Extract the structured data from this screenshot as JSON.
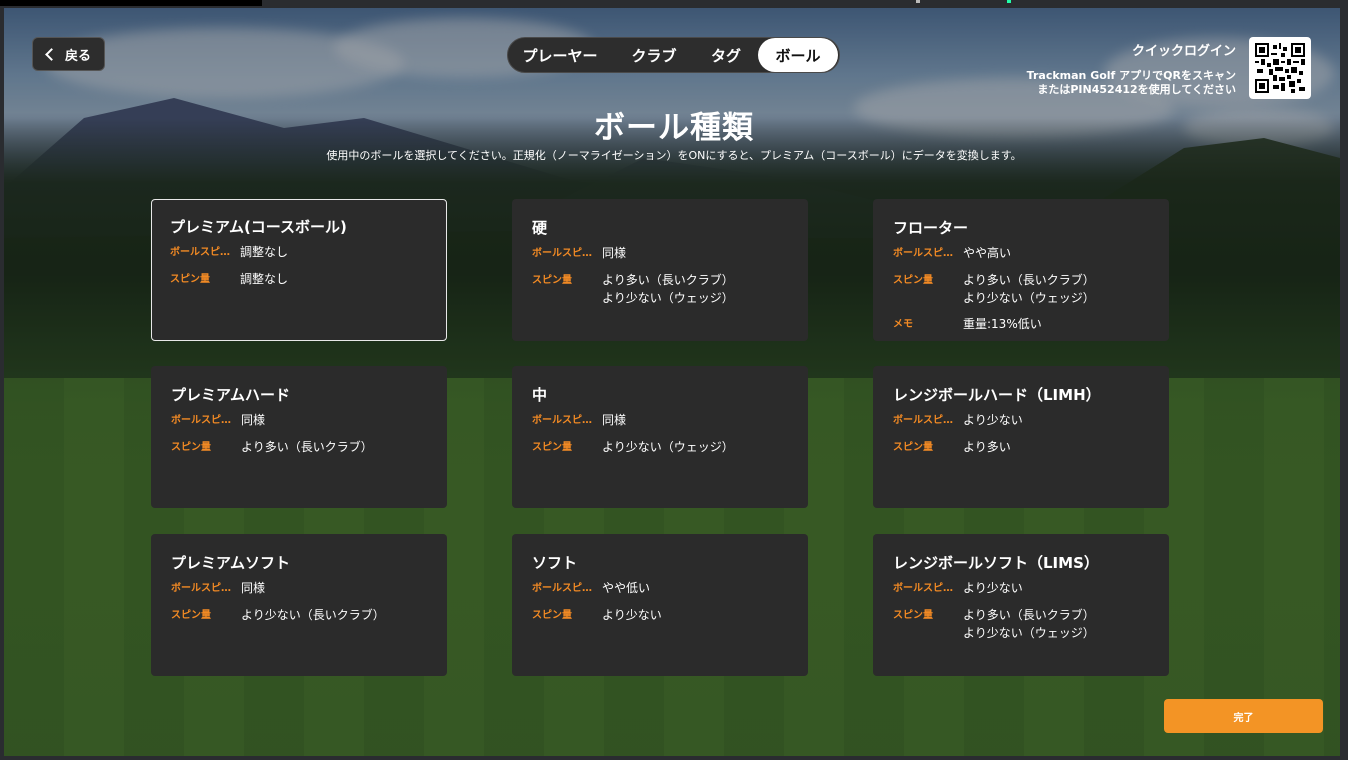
{
  "header": {
    "back_label": "戻る",
    "tabs": [
      {
        "label": "プレーヤー",
        "active": false
      },
      {
        "label": "クラブ",
        "active": false
      },
      {
        "label": "タグ",
        "active": false
      },
      {
        "label": "ボール",
        "active": true
      }
    ],
    "quick_login": {
      "title": "クイックログイン",
      "line1": "Trackman Golf アプリでQRをスキャン",
      "line2": "またはPIN452412を使用してください"
    }
  },
  "page": {
    "title": "ボール種類",
    "subtitle": "使用中のボールを選択してください。正規化（ノーマライゼーション）をONにすると、プレミアム（コースボール）にデータを変換します。"
  },
  "cards": [
    {
      "name": "プレミアム(コースボール)",
      "selected": true,
      "rows": [
        {
          "key": "ボールスピ…",
          "value": "調整なし"
        },
        {
          "key": "スピン量",
          "value": "調整なし"
        }
      ]
    },
    {
      "name": "硬",
      "selected": false,
      "rows": [
        {
          "key": "ボールスピ…",
          "value": "同様"
        },
        {
          "key": "スピン量",
          "value": "より多い（長いクラブ）\nより少ない（ウェッジ）"
        }
      ]
    },
    {
      "name": "フローター",
      "selected": false,
      "rows": [
        {
          "key": "ボールスピ…",
          "value": "やや高い"
        },
        {
          "key": "スピン量",
          "value": "より多い（長いクラブ）\nより少ない（ウェッジ）"
        },
        {
          "key": "メモ",
          "value": "重量:13%低い"
        }
      ]
    },
    {
      "name": "プレミアムハード",
      "selected": false,
      "rows": [
        {
          "key": "ボールスピ…",
          "value": "同様"
        },
        {
          "key": "スピン量",
          "value": "より多い（長いクラブ）"
        }
      ]
    },
    {
      "name": "中",
      "selected": false,
      "rows": [
        {
          "key": "ボールスピ…",
          "value": "同様"
        },
        {
          "key": "スピン量",
          "value": "より少ない（ウェッジ）"
        }
      ]
    },
    {
      "name": "レンジボールハード（LIMH）",
      "selected": false,
      "rows": [
        {
          "key": "ボールスピ…",
          "value": "より少ない"
        },
        {
          "key": "スピン量",
          "value": "より多い"
        }
      ]
    },
    {
      "name": "プレミアムソフト",
      "selected": false,
      "rows": [
        {
          "key": "ボールスピ…",
          "value": "同様"
        },
        {
          "key": "スピン量",
          "value": "より少ない（長いクラブ）"
        }
      ]
    },
    {
      "name": "ソフト",
      "selected": false,
      "rows": [
        {
          "key": "ボールスピ…",
          "value": "やや低い"
        },
        {
          "key": "スピン量",
          "value": "より少ない"
        }
      ]
    },
    {
      "name": "レンジボールソフト（LIMS）",
      "selected": false,
      "rows": [
        {
          "key": "ボールスピ…",
          "value": "より少ない"
        },
        {
          "key": "スピン量",
          "value": "より多い（長いクラブ）\nより少ない（ウェッジ）"
        }
      ]
    }
  ],
  "footer": {
    "done_label": "完了"
  },
  "colors": {
    "accent": "#f39425",
    "label": "#f28a24",
    "card": "#2b2b2b"
  },
  "icons": {
    "back": "chevron-left-icon",
    "qr": "qr-code-icon"
  }
}
